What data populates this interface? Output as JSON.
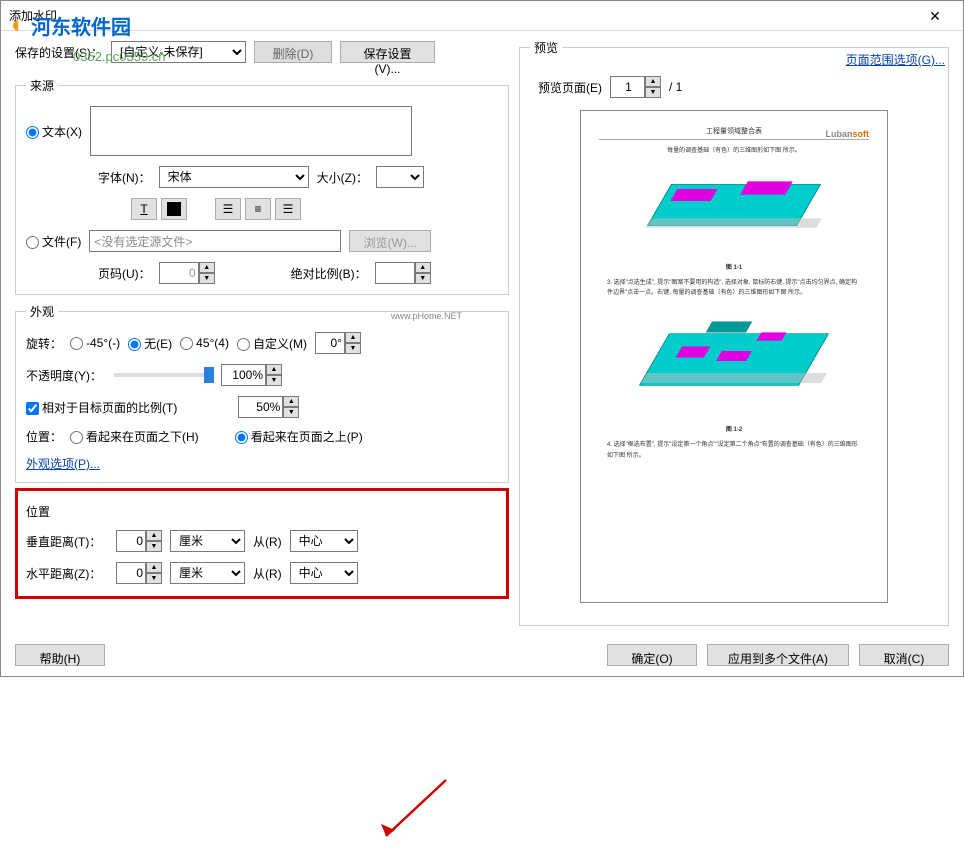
{
  "window": {
    "title": "添加水印"
  },
  "logo": {
    "main": "河东软件园",
    "sub": "0352.pc0359.cn"
  },
  "toolbar": {
    "saved_settings_label": "保存的设置(S)：",
    "saved_settings_value": "[自定义-未保存]",
    "delete_btn": "删除(D)",
    "save_settings_btn": "保存设置(V)..."
  },
  "page_range_link": "页面范围选项(G)...",
  "source": {
    "legend": "来源",
    "text_radio": "文本(X)",
    "font_label": "字体(N)：",
    "font_value": "宋体",
    "size_label": "大小(Z)：",
    "size_value": "",
    "file_radio": "文件(F)",
    "file_value": "<没有选定源文件>",
    "browse_btn": "浏览(W)...",
    "page_num_label": "页码(U)：",
    "page_num_value": "0",
    "abs_ratio_label": "绝对比例(B)：",
    "abs_ratio_value": ""
  },
  "appearance": {
    "legend": "外观",
    "rotation_label": "旋转：",
    "neg45": "-45°(-)",
    "none": "无(E)",
    "pos45": "45°(4)",
    "custom": "自定义(M)",
    "custom_value": "0°",
    "opacity_label": "不透明度(Y)：",
    "opacity_value": "100%",
    "relative_scale_label": "相对于目标页面的比例(T)",
    "relative_scale_value": "50%",
    "position_label": "位置：",
    "below": "看起来在页面之下(H)",
    "above": "看起来在页面之上(P)",
    "options_link": "外观选项(P)..."
  },
  "position": {
    "legend": "位置",
    "vdist_label": "垂直距离(T)：",
    "vdist_value": "0",
    "vdist_unit": "厘米",
    "from_label": "从(R)",
    "vdist_anchor": "中心",
    "hdist_label": "水平距离(Z)：",
    "hdist_value": "0",
    "hdist_unit": "厘米",
    "hdist_anchor": "中心"
  },
  "preview": {
    "legend": "预览",
    "page_label": "预览页面(E)",
    "page_value": "1",
    "total_pages": "/ 1",
    "doc_title": "工程量领域整合表",
    "brand_luban": "Luban",
    "brand_soft": "soft",
    "caption1_prefix": "每量的调查基础（有色）的三维图形如下图",
    "caption1_suffix": "所示。",
    "fig1": "图 1-1",
    "mid_text1": "3. 选择\"点选生成\", 提示\"图案不要用的构造\", 选择对象, 鼠标防右键, 提示\"点击均匀界点, 确定构件边界\"点击一点。右键, 每量的调查基础（有色）的三维图形如下图 所示。",
    "fig2": "图 1-2",
    "mid_text2": "4. 选择\"框选布置\", 提示\"设定第一个角点\"\"设定第二个角点\"布置的调查基础（有色）的三维图形如下图 所示。"
  },
  "watermark_overlay": "www.pHome.NET",
  "buttons": {
    "help": "帮助(H)",
    "ok": "确定(O)",
    "apply_multi": "应用到多个文件(A)",
    "cancel": "取消(C)"
  }
}
